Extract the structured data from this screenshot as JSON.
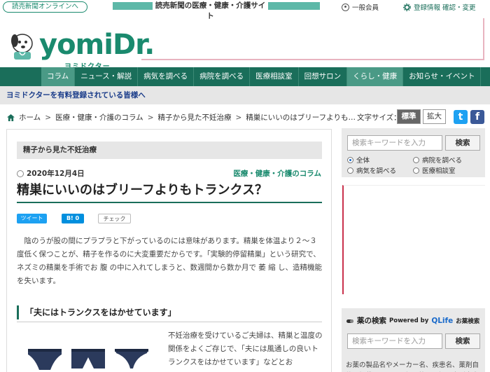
{
  "topbar": {
    "online_label": "読売新聞オンラインへ",
    "tagline": "読売新聞の医療・健康・介護サイト",
    "member_label": "一般会員",
    "reg_label": "登録情報 確認・変更"
  },
  "logo": {
    "text": "yomiDr.",
    "sub": "ヨミドクター"
  },
  "nav": {
    "items": [
      "コラム",
      "ニュース・解説",
      "病気を調べる",
      "病院を調べる",
      "医療相談室",
      "回想サロン",
      "くらし・健康",
      "お知らせ・イベント"
    ]
  },
  "member_banner": "ヨミドクターを有料登録されている皆様へ",
  "breadcrumb": {
    "items": [
      "ホーム",
      "医療・健康・介護のコラム",
      "精子から見た不妊治療",
      "精巣にいいのはブリーフよりも…"
    ],
    "sep": ">"
  },
  "textsize": {
    "label": "文字サイズ：",
    "standard": "標準",
    "large": "拡大"
  },
  "sns": {
    "twitter": "t",
    "facebook": "f"
  },
  "article": {
    "series": "精子から見た不妊治療",
    "date": "2020年12月4日",
    "category": "医療・健康・介護のコラム",
    "title": "精巣にいいのはブリーフよりもトランクス？",
    "share_tweet": "ツイート",
    "share_hatena": "B! 0",
    "share_check": "チェック",
    "paragraph": "陰のうが股の間にプラプラと下がっているのには意味があります。精巣を体温より２～３度低く保つことが、精子を作るのに大変重要だからです。「実験的停留精巣」という研究で、ネズミの精巣を手術でお 腹 の中に入れてしまうと、数週間から数か月で 萎 縮 し、造精機能を失います。",
    "heading": "「夫にはトランクスをはかせています」",
    "side_text": "不妊治療を受けているご夫婦は、精巣と温度の関係をよくご存じで、「夫には風通しの良いトランクスをはかせています」などとお"
  },
  "sidebar": {
    "search_placeholder": "検索キーワードを入力",
    "search_button": "検索",
    "radios": [
      "全体",
      "病院を調べる",
      "病気を調べる",
      "医療相談室"
    ],
    "drug_title": "薬の検索",
    "powered_by": "Powered by",
    "qlife": "QLife",
    "drug_suffix": "お薬検索",
    "drug_placeholder": "検索キーワードを入力",
    "drug_button": "検索",
    "drug_note": "お薬の製品名やメーカー名、疾患名、薬剤自体に記載されている記号等から探す事が出来"
  },
  "colors": {
    "brand": "#1a6e5a",
    "accent": "#1a8a6e",
    "nav_active": "#4a9a86",
    "ad_border": "#c9324c"
  }
}
